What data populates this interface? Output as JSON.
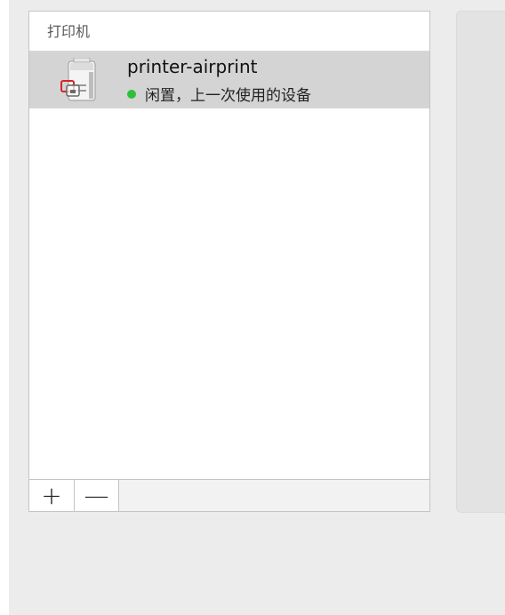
{
  "printer_list": {
    "header": "打印机",
    "printers": [
      {
        "name": "printer-airprint",
        "status_text": "闲置，上一次使用的设备",
        "status_color": "#2dbf3a",
        "icon": "printer-icon",
        "selected": true
      }
    ],
    "add_label": "+",
    "remove_label": "—"
  }
}
